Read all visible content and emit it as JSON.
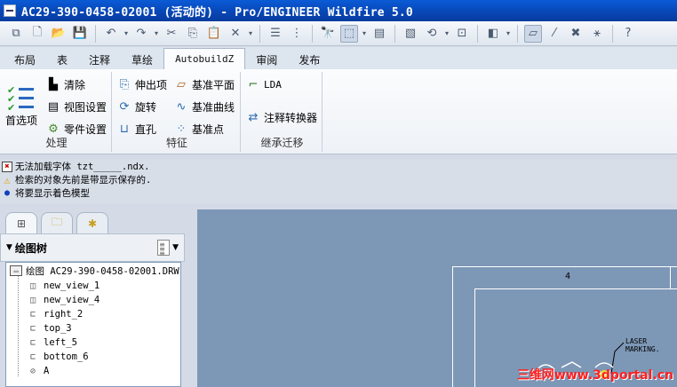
{
  "window": {
    "title": "AC29-390-0458-02001 (活动的) - Pro/ENGINEER Wildfire 5.0"
  },
  "quick_toolbar": {
    "icons": [
      "assembly-icon",
      "new-icon",
      "open-icon",
      "save-icon",
      "undo-icon",
      "redo-icon",
      "cut-icon",
      "copy-icon",
      "paste-icon",
      "delete-icon",
      "layers-icon",
      "tree-icon",
      "find-icon",
      "select-box-icon",
      "model-tree-icon",
      "sheet-icon",
      "regen-icon",
      "zoom-icon",
      "display-style-icon",
      "datum-plane-display-icon",
      "datum-axis-display-icon",
      "datum-point-display-icon",
      "datum-csys-display-icon",
      "help-icon"
    ]
  },
  "tabs": [
    "布局",
    "表",
    "注释",
    "草绘",
    "AutobuildZ",
    "审阅",
    "发布"
  ],
  "active_tab": "AutobuildZ",
  "ribbon": {
    "process": {
      "label": "处理",
      "preferences": "首选项",
      "clear": "清除",
      "view_settings": "视图设置",
      "part_settings": "零件设置"
    },
    "features": {
      "label": "特征",
      "extrude": "伸出项",
      "revolve": "旋转",
      "straight_hole": "直孔",
      "datum_plane": "基准平面",
      "datum_curve": "基准曲线",
      "datum_point": "基准点"
    },
    "legacy": {
      "label": "继承迁移",
      "lda": "LDA",
      "annotation_converter": "注释转换器"
    }
  },
  "messages": [
    {
      "type": "error",
      "text": "无法加载字体 tzt_____.ndx."
    },
    {
      "type": "warning",
      "text": "检索的对象先前是带显示保存的."
    },
    {
      "type": "info",
      "text": "将要显示着色模型"
    }
  ],
  "left_panel": {
    "title": "绘图树",
    "items": [
      {
        "label": "绘图 AC29-390-0458-02001.DRW",
        "icon": "drawing-icon"
      },
      {
        "label": "new_view_1",
        "icon": "general-view-icon"
      },
      {
        "label": "new_view_4",
        "icon": "general-view-icon"
      },
      {
        "label": "right_2",
        "icon": "projection-view-icon"
      },
      {
        "label": "top_3",
        "icon": "projection-view-icon"
      },
      {
        "label": "left_5",
        "icon": "projection-view-icon"
      },
      {
        "label": "bottom_6",
        "icon": "projection-view-icon"
      },
      {
        "label": "A",
        "icon": "detail-view-icon"
      }
    ]
  },
  "drawing": {
    "zone_label": "4",
    "note": "LASER MARKING.",
    "watermark": "三维网www.3dportal.cn"
  }
}
